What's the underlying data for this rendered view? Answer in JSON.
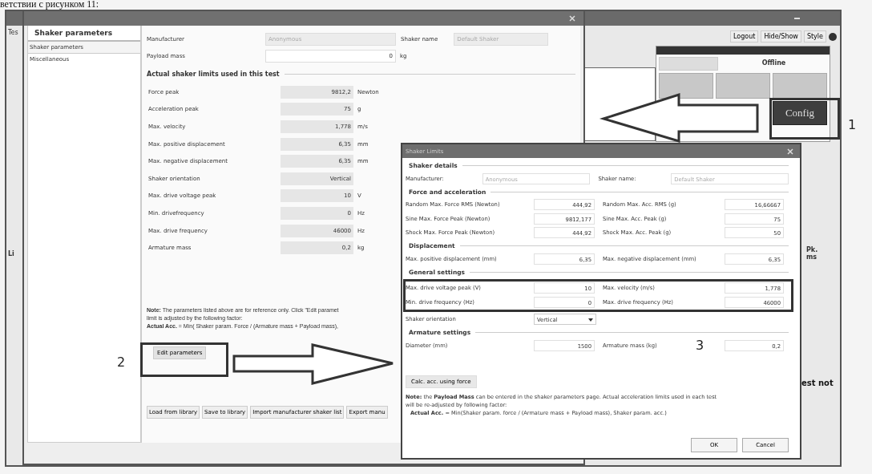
{
  "caption": "ветствии с рисунком 11:",
  "main_window": {
    "menu_label": "Tes",
    "list_label": "Li",
    "toolbar": [
      "Logout",
      "Hide/Show",
      "Style"
    ],
    "control_panel": {
      "status": "Offline",
      "config_button": "Config"
    },
    "column_header": [
      "Pk.",
      "ms"
    ],
    "message_fragment": "est not"
  },
  "config_window": {
    "sidebar": {
      "title": "Shaker parameters",
      "items": [
        {
          "label": "Shaker parameters",
          "selected": true
        },
        {
          "label": "Miscellaneous",
          "selected": false
        }
      ]
    },
    "manufacturer": {
      "label": "Manufacturer",
      "value": "Anonymous"
    },
    "shaker_name": {
      "label": "Shaker name",
      "value": "Default Shaker"
    },
    "payload": {
      "label": "Payload mass",
      "value": "0",
      "unit": "kg"
    },
    "limits_title": "Actual shaker limits used in this test",
    "limits": [
      {
        "label": "Force peak",
        "value": "9812,2",
        "unit": "Newton"
      },
      {
        "label": "Acceleration peak",
        "value": "75",
        "unit": "g"
      },
      {
        "label": "Max. velocity",
        "value": "1,778",
        "unit": "m/s"
      },
      {
        "label": "Max. positive displacement",
        "value": "6,35",
        "unit": "mm"
      },
      {
        "label": "Max. negative displacement",
        "value": "6,35",
        "unit": "mm"
      },
      {
        "label": "Shaker orientation",
        "value": "Vertical"
      },
      {
        "label": "Max. drive voltage peak",
        "value": "10",
        "unit": "V"
      },
      {
        "label": "Min. drivefrequency",
        "value": "0",
        "unit": "Hz"
      },
      {
        "label": "Max. drive frequency",
        "value": "46000",
        "unit": "Hz"
      },
      {
        "label": "Armature mass",
        "value": "0,2",
        "unit": "kg"
      }
    ],
    "note": [
      "**Note:** The parameters listed above are for reference only. Click \"Edit paramet",
      "limit is adjusted by the following factor:",
      "**Actual Acc.** = Min( Shaker param. Force / (Armature mass + Payload mass),"
    ],
    "edit_button": "Edit parameters",
    "buttons": [
      "Load from library",
      "Save to library",
      "Import manufacturer shaker list",
      "Export manu"
    ]
  },
  "dialog": {
    "title": "Shaker Limits",
    "sections": [
      {
        "title": "Shaker details",
        "rows": [
          {
            "kind": "pair",
            "cells": [
              {
                "label": "Manufacturer:",
                "value": "Anonymous",
                "disabled": true
              },
              {
                "label": "Shaker name:",
                "value": "Default Shaker",
                "disabled": true
              }
            ]
          }
        ]
      },
      {
        "title": "Force and acceleration",
        "rows": [
          {
            "kind": "pair",
            "cells": [
              {
                "label": "Random Max. Force RMS (Newton)",
                "value": "444,92",
                "disabled": false
              },
              {
                "label": "Random Max. Acc. RMS (g)",
                "value": "16,66667",
                "disabled": false
              }
            ]
          },
          {
            "kind": "pair",
            "cells": [
              {
                "label": "Sine Max. Force Peak (Newton)",
                "value": "9812,177",
                "disabled": false
              },
              {
                "label": "Sine Max. Acc. Peak (g)",
                "value": "75",
                "disabled": false
              }
            ]
          },
          {
            "kind": "pair",
            "cells": [
              {
                "label": "Shock Max. Force Peak (Newton)",
                "value": "444,92",
                "disabled": false
              },
              {
                "label": "Shock Max. Acc. Peak (g)",
                "value": "50",
                "disabled": false
              }
            ]
          }
        ]
      },
      {
        "title": "Displacement",
        "rows": [
          {
            "kind": "pair",
            "cells": [
              {
                "label": "Max. positive displacement (mm)",
                "value": "6,35",
                "disabled": false
              },
              {
                "label": "Max. negative displacement (mm)",
                "value": "6,35",
                "disabled": false
              }
            ]
          }
        ]
      },
      {
        "title": "General settings",
        "rows": [
          {
            "kind": "pair",
            "highlighted": true,
            "cells": [
              {
                "label": "Max. drive voltage peak (V)",
                "value": "10",
                "disabled": false
              },
              {
                "label": "Max. velocity (m/s)",
                "value": "1,778",
                "disabled": false
              }
            ]
          },
          {
            "kind": "pair",
            "highlighted": true,
            "cells": [
              {
                "label": "Min. drive frequency (Hz)",
                "value": "0",
                "disabled": false
              },
              {
                "label": "Max. drive frequency (Hz)",
                "value": "46000",
                "disabled": false
              }
            ]
          },
          {
            "kind": "select",
            "highlighted": false,
            "label": "Shaker orientation",
            "value": "Vertical"
          }
        ]
      },
      {
        "title": "Armature settings",
        "rows": [
          {
            "kind": "pair",
            "cells": [
              {
                "label": "Diameter (mm)",
                "value": "1500",
                "disabled": false
              },
              {
                "label": "Armature mass (kg)",
                "value": "0,2",
                "disabled": false
              }
            ]
          }
        ]
      }
    ],
    "calc_button": "Calc. acc. using force",
    "note": [
      "**Note:** the **Payload Mass** can be entered in the shaker parameters page. Actual acceleration limits used in each test",
      "will be re-adjusted by following factor:",
      "**Actual Acc.** = Min(Shaker param. force / (Armature mass + Payload mass), Shaker param. acc.)"
    ],
    "buttons": [
      "OK",
      "Cancel"
    ]
  },
  "annotations": [
    "1",
    "2",
    "3"
  ]
}
